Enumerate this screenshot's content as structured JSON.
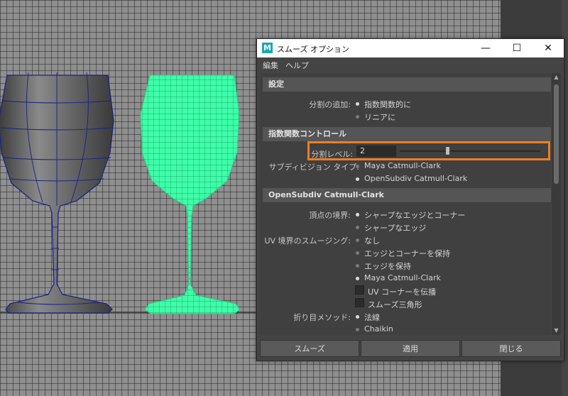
{
  "dialog": {
    "title": "スムーズ オプション",
    "logo": "M",
    "controls": {
      "minimize": "—",
      "maximize": "☐",
      "close": "✕"
    },
    "menu": [
      "編集",
      "ヘルプ"
    ]
  },
  "sections": {
    "settings": "設定",
    "exponential": "指数関数コントロール",
    "opensubdiv": "OpenSubdiv Catmull-Clark"
  },
  "settings": {
    "add_divisions_label": "分割の追加:",
    "options": [
      "指数関数的に",
      "リニアに"
    ],
    "selected": 0
  },
  "exponential": {
    "division_level_label": "分割レベル:",
    "division_level_value": "2",
    "slider_fraction": 0.34,
    "subdivision_type_label": "サブディビジョン タイプ:",
    "subdivision_types": [
      "Maya Catmull-Clark",
      "OpenSubdiv Catmull-Clark"
    ],
    "subdivision_selected": 1
  },
  "opensubdiv": {
    "vertex_boundary_label": "頂点の境界:",
    "vertex_boundary_options": [
      "シャープなエッジとコーナー",
      "シャープなエッジ"
    ],
    "vertex_boundary_selected": 0,
    "uv_smoothing_label": "UV 境界のスムージング:",
    "uv_smoothing_options": [
      "なし",
      "エッジとコーナーを保持",
      "エッジを保持",
      "Maya Catmull-Clark"
    ],
    "uv_smoothing_selected": 3,
    "propagate_uv_corners": "UV コーナーを伝播",
    "smooth_triangles": "スムーズ三角形",
    "crease_method_label": "折り目メソッド:",
    "crease_methods": [
      "法線",
      "Chaikin"
    ],
    "crease_selected": 0
  },
  "footer": {
    "smooth": "スムーズ",
    "apply": "適用",
    "close": "閉じる"
  },
  "colors": {
    "highlight": "#ee7e1f",
    "wireframe_selected": "#3dffa9",
    "wireframe": "#1a1f8a"
  },
  "icons": {
    "logo": "maya-logo-icon"
  }
}
